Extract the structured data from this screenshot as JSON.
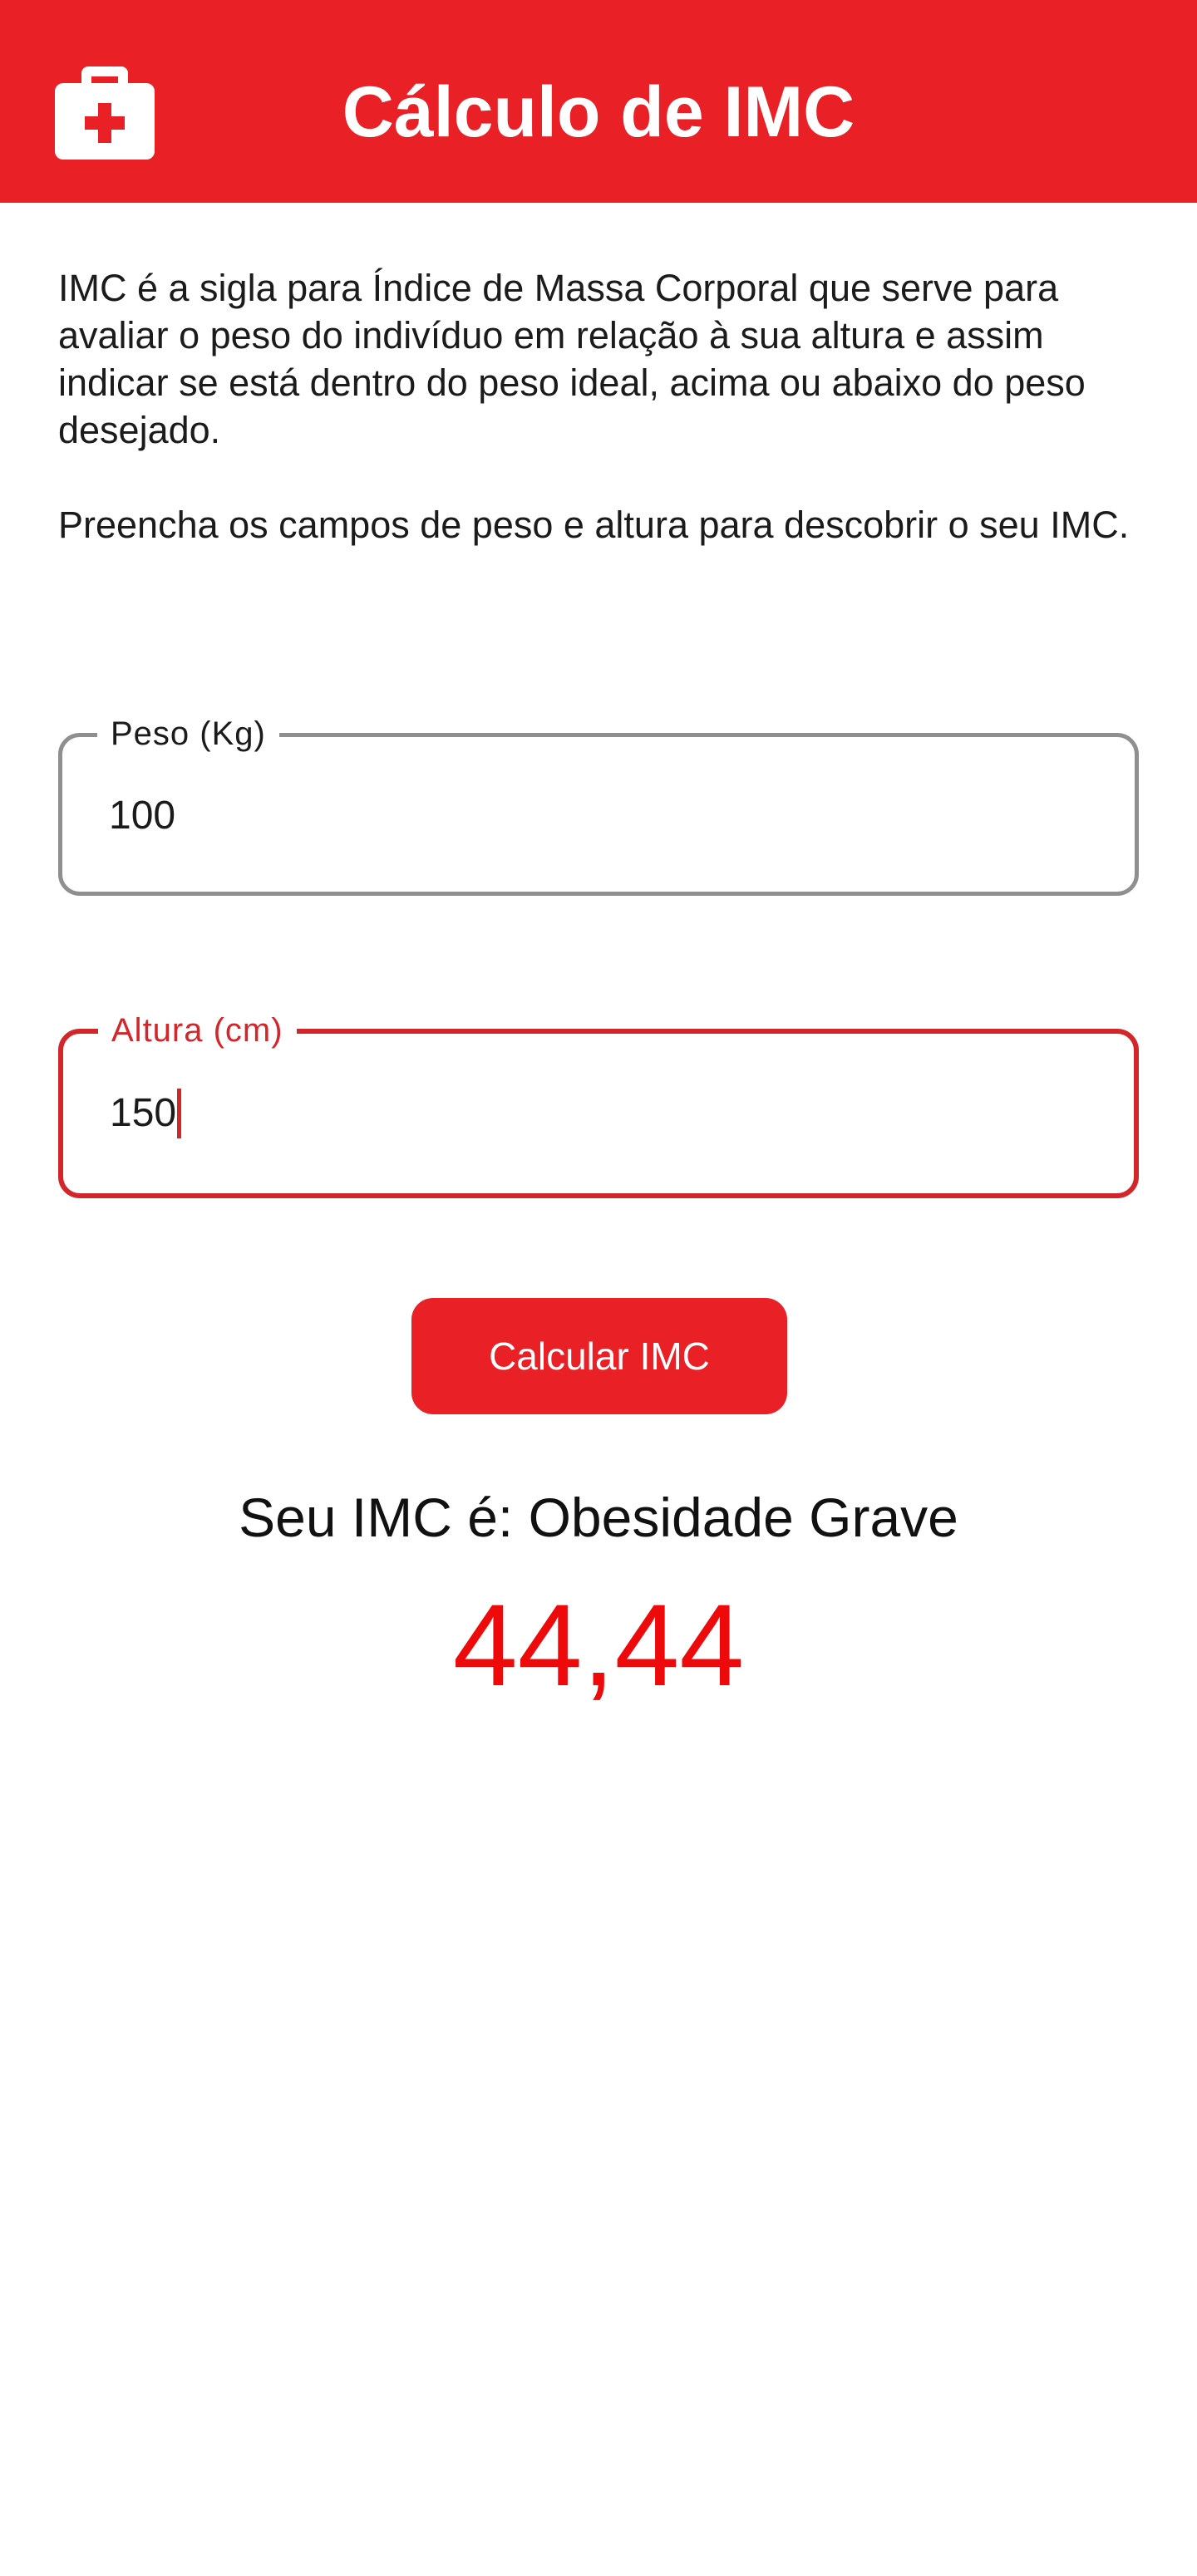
{
  "app_bar": {
    "title": "Cálculo de IMC",
    "icon": "medical-kit-icon",
    "background_color": "#e92127"
  },
  "description": {
    "paragraph_1": "IMC é a sigla para Índice de Massa Corporal que serve para avaliar o peso do indivíduo em relação à sua altura e assim indicar se está dentro do peso ideal, acima ou abaixo do peso desejado.",
    "paragraph_2": "Preencha os campos de peso e altura para descobrir o seu IMC."
  },
  "form": {
    "weight": {
      "label": "Peso (Kg)",
      "value": "100",
      "focused": false
    },
    "height": {
      "label": "Altura (cm)",
      "value": "150",
      "focused": true,
      "accent_color": "#d2262b"
    },
    "submit_label": "Calcular IMC"
  },
  "result": {
    "label": "Seu IMC é: Obesidade Grave",
    "value": "44,44",
    "value_color": "#ee0a0a"
  }
}
